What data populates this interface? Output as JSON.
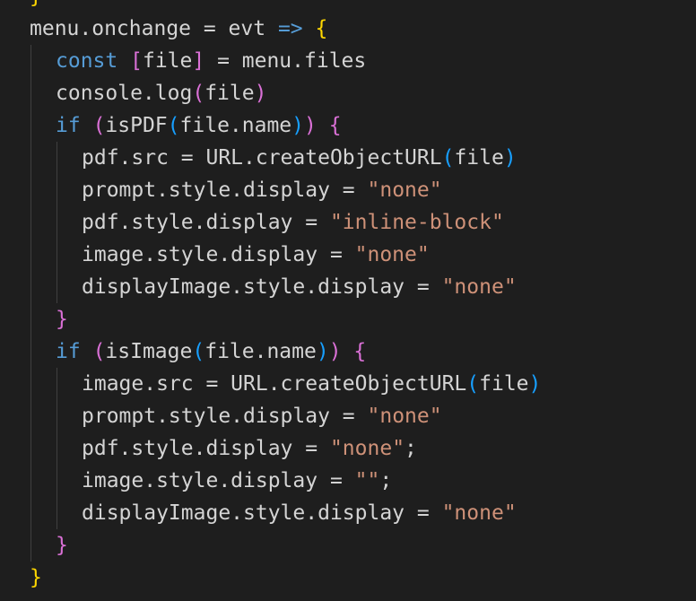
{
  "editor": {
    "colors": {
      "background": "#1e1e1e",
      "default": "#d4d4d4",
      "keyword": "#569cd6",
      "string": "#ce9178",
      "brace_level_1": "#ffd700",
      "brace_level_2": "#da70d6",
      "brace_level_3": "#179fff"
    },
    "lines": [
      {
        "indent": 0,
        "tokens": [
          {
            "t": "}",
            "c": "brace1"
          }
        ]
      },
      {
        "indent": 0,
        "tokens": [
          {
            "t": "menu.onchange = evt ",
            "c": "default"
          },
          {
            "t": "=>",
            "c": "arrow"
          },
          {
            "t": " ",
            "c": "default"
          },
          {
            "t": "{",
            "c": "brace1"
          }
        ]
      },
      {
        "indent": 1,
        "tokens": [
          {
            "t": "const",
            "c": "keyword"
          },
          {
            "t": " ",
            "c": "default"
          },
          {
            "t": "[",
            "c": "brace2"
          },
          {
            "t": "file",
            "c": "default"
          },
          {
            "t": "]",
            "c": "brace2"
          },
          {
            "t": " = menu.files",
            "c": "default"
          }
        ]
      },
      {
        "indent": 1,
        "tokens": [
          {
            "t": "console.log",
            "c": "default"
          },
          {
            "t": "(",
            "c": "brace2"
          },
          {
            "t": "file",
            "c": "default"
          },
          {
            "t": ")",
            "c": "brace2"
          }
        ]
      },
      {
        "indent": 1,
        "tokens": [
          {
            "t": "if",
            "c": "keyword"
          },
          {
            "t": " ",
            "c": "default"
          },
          {
            "t": "(",
            "c": "brace2"
          },
          {
            "t": "isPDF",
            "c": "default"
          },
          {
            "t": "(",
            "c": "brace3"
          },
          {
            "t": "file.name",
            "c": "default"
          },
          {
            "t": ")",
            "c": "brace3"
          },
          {
            "t": ")",
            "c": "brace2"
          },
          {
            "t": " ",
            "c": "default"
          },
          {
            "t": "{",
            "c": "brace2"
          }
        ]
      },
      {
        "indent": 2,
        "tokens": [
          {
            "t": "pdf.src = URL.createObjectURL",
            "c": "default"
          },
          {
            "t": "(",
            "c": "brace3"
          },
          {
            "t": "file",
            "c": "default"
          },
          {
            "t": ")",
            "c": "brace3"
          }
        ]
      },
      {
        "indent": 2,
        "tokens": [
          {
            "t": "prompt.style.display = ",
            "c": "default"
          },
          {
            "t": "\"none\"",
            "c": "string"
          }
        ]
      },
      {
        "indent": 2,
        "tokens": [
          {
            "t": "pdf.style.display = ",
            "c": "default"
          },
          {
            "t": "\"inline-block\"",
            "c": "string"
          }
        ]
      },
      {
        "indent": 2,
        "tokens": [
          {
            "t": "image.style.display = ",
            "c": "default"
          },
          {
            "t": "\"none\"",
            "c": "string"
          }
        ]
      },
      {
        "indent": 2,
        "tokens": [
          {
            "t": "displayImage.style.display = ",
            "c": "default"
          },
          {
            "t": "\"none\"",
            "c": "string"
          }
        ]
      },
      {
        "indent": 1,
        "tokens": [
          {
            "t": "}",
            "c": "brace2"
          }
        ]
      },
      {
        "indent": 1,
        "tokens": [
          {
            "t": "if",
            "c": "keyword"
          },
          {
            "t": " ",
            "c": "default"
          },
          {
            "t": "(",
            "c": "brace2"
          },
          {
            "t": "isImage",
            "c": "default"
          },
          {
            "t": "(",
            "c": "brace3"
          },
          {
            "t": "file.name",
            "c": "default"
          },
          {
            "t": ")",
            "c": "brace3"
          },
          {
            "t": ")",
            "c": "brace2"
          },
          {
            "t": " ",
            "c": "default"
          },
          {
            "t": "{",
            "c": "brace2"
          }
        ]
      },
      {
        "indent": 2,
        "tokens": [
          {
            "t": "image.src = URL.createObjectURL",
            "c": "default"
          },
          {
            "t": "(",
            "c": "brace3"
          },
          {
            "t": "file",
            "c": "default"
          },
          {
            "t": ")",
            "c": "brace3"
          }
        ]
      },
      {
        "indent": 2,
        "tokens": [
          {
            "t": "prompt.style.display = ",
            "c": "default"
          },
          {
            "t": "\"none\"",
            "c": "string"
          }
        ]
      },
      {
        "indent": 2,
        "tokens": [
          {
            "t": "pdf.style.display = ",
            "c": "default"
          },
          {
            "t": "\"none\"",
            "c": "string"
          },
          {
            "t": ";",
            "c": "default"
          }
        ]
      },
      {
        "indent": 2,
        "tokens": [
          {
            "t": "image.style.display = ",
            "c": "default"
          },
          {
            "t": "\"\"",
            "c": "string"
          },
          {
            "t": ";",
            "c": "default"
          }
        ]
      },
      {
        "indent": 2,
        "tokens": [
          {
            "t": "displayImage.style.display = ",
            "c": "default"
          },
          {
            "t": "\"none\"",
            "c": "string"
          }
        ]
      },
      {
        "indent": 1,
        "tokens": [
          {
            "t": "}",
            "c": "brace2"
          }
        ]
      },
      {
        "indent": 0,
        "tokens": [
          {
            "t": "}",
            "c": "brace1"
          }
        ]
      },
      {
        "indent": 0,
        "tokens": [
          {
            "t": "//",
            "c": "default"
          }
        ]
      }
    ]
  }
}
